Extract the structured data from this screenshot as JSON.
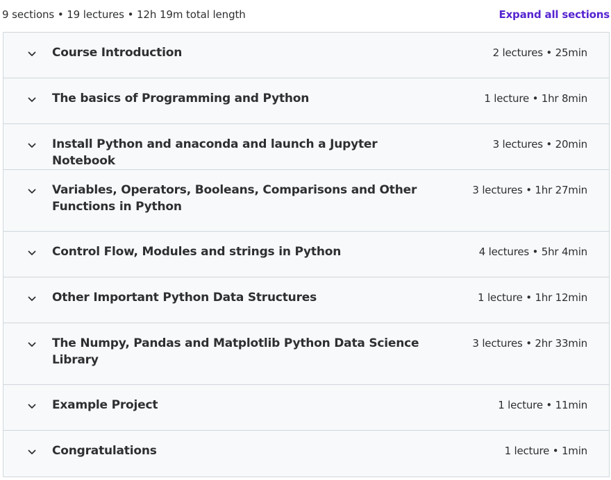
{
  "summary": {
    "text": "9 sections • 19 lectures • 12h 19m total length",
    "expand_label": "Expand all sections"
  },
  "sections": [
    {
      "title": "Course Introduction",
      "meta": "2 lectures • 25min"
    },
    {
      "title": "The basics of Programming and Python",
      "meta": "1 lecture • 1hr 8min"
    },
    {
      "title": "Install Python and anaconda and launch a Jupyter Notebook",
      "meta": "3 lectures • 20min"
    },
    {
      "title": "Variables, Operators, Booleans, Comparisons and Other Functions in Python",
      "meta": "3 lectures • 1hr 27min"
    },
    {
      "title": "Control Flow, Modules and strings in Python",
      "meta": "4 lectures • 5hr 4min"
    },
    {
      "title": "Other Important Python Data Structures",
      "meta": "1 lecture • 1hr 12min"
    },
    {
      "title": "The Numpy, Pandas and Matplotlib Python Data Science Library",
      "meta": "3 lectures • 2hr 33min"
    },
    {
      "title": "Example Project",
      "meta": "1 lecture • 11min"
    },
    {
      "title": "Congratulations",
      "meta": "1 lecture • 1min"
    }
  ],
  "icons": {
    "section_toggle": "chevron-down-icon"
  },
  "colors": {
    "accent": "#5624d0",
    "row_bg": "#f7f9fa",
    "border": "#d1d7dc",
    "text": "#2d2f31"
  }
}
